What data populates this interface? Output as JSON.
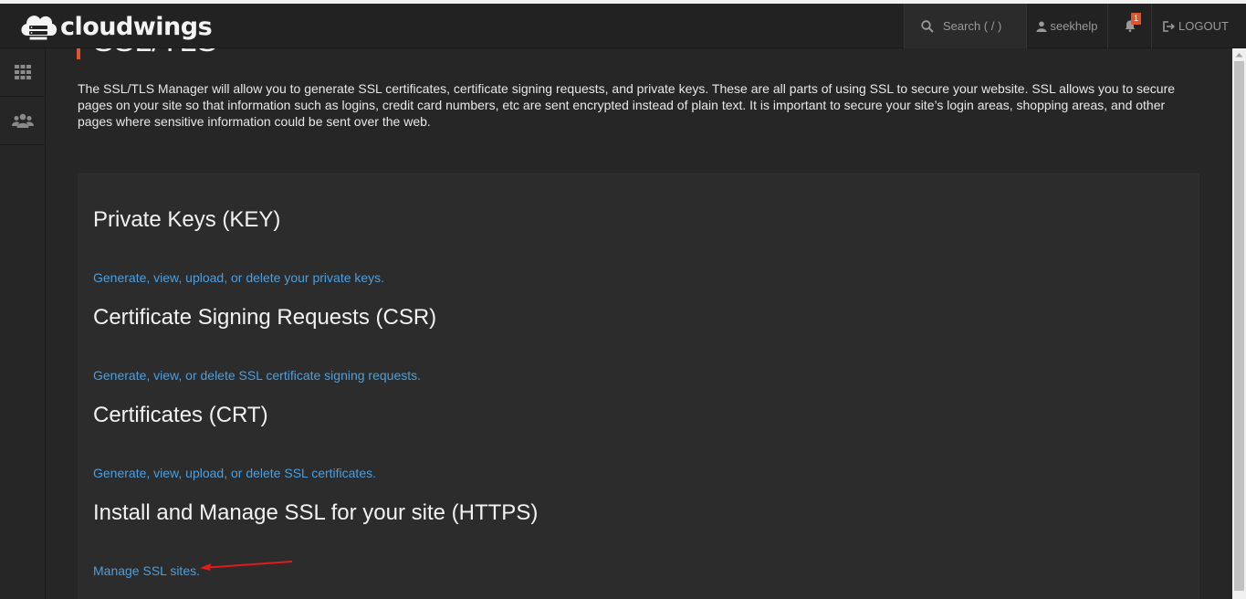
{
  "app": {
    "logo_text": "cloudwings"
  },
  "header": {
    "search_placeholder": "Search ( / )",
    "username": "seekhelp",
    "notification_count": "1",
    "logout_label": "LOGOUT"
  },
  "sidebar": {
    "items": [
      {
        "icon": "grid-icon"
      },
      {
        "icon": "users-icon"
      }
    ]
  },
  "page": {
    "title": "SSL/TLS",
    "intro": "The SSL/TLS Manager will allow you to generate SSL certificates, certificate signing requests, and private keys. These are all parts of using SSL to secure your website. SSL allows you to secure pages on your site so that information such as logins, credit card numbers, etc are sent encrypted instead of plain text. It is important to secure your site’s login areas, shopping areas, and other pages where sensitive information could be sent over the web.",
    "sections": [
      {
        "title": "Private Keys (KEY)",
        "link": "Generate, view, upload, or delete your private keys."
      },
      {
        "title": "Certificate Signing Requests (CSR)",
        "link": "Generate, view, or delete SSL certificate signing requests."
      },
      {
        "title": "Certificates (CRT)",
        "link": "Generate, view, upload, or delete SSL certificates."
      },
      {
        "title": "Install and Manage SSL for your site (HTTPS)",
        "link": "Manage SSL sites."
      }
    ]
  },
  "colors": {
    "accent": "#e3542a",
    "link": "#4b9fe0",
    "background": "#262626",
    "panel": "#2c2c2c",
    "annotation_arrow": "#e01b1b"
  }
}
